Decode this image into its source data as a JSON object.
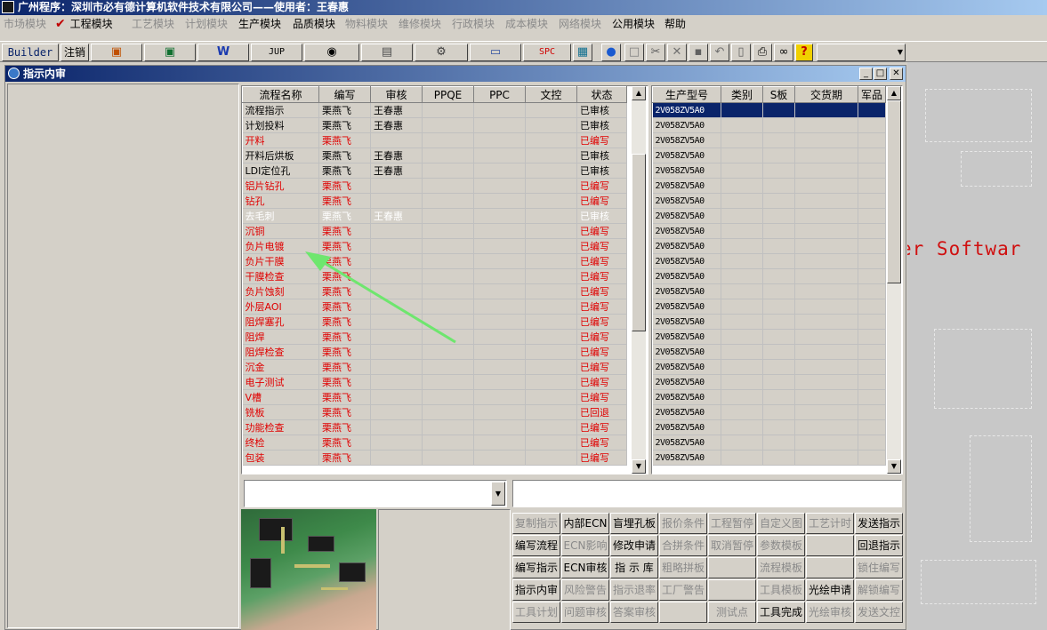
{
  "app": {
    "title": "广州程序：深圳市必有德计算机软件技术有限公司——使用者：王春惠"
  },
  "menu": [
    {
      "label": "市场模块",
      "enabled": false
    },
    {
      "label": "工程模块",
      "enabled": true,
      "checked": true
    },
    {
      "label": "工艺模块",
      "enabled": false
    },
    {
      "label": "计划模块",
      "enabled": false
    },
    {
      "label": "生产模块",
      "enabled": true
    },
    {
      "label": "品质模块",
      "enabled": true
    },
    {
      "label": "物料模块",
      "enabled": false
    },
    {
      "label": "维修模块",
      "enabled": false
    },
    {
      "label": "行政模块",
      "enabled": false
    },
    {
      "label": "成本模块",
      "enabled": false
    },
    {
      "label": "网络模块",
      "enabled": false
    },
    {
      "label": "公用模块",
      "enabled": true
    },
    {
      "label": "帮助",
      "enabled": true
    }
  ],
  "toolbar": {
    "builder": "Builder",
    "logout": "注销",
    "jup": "JUP",
    "spc": "SPC",
    "icons": [
      "ppt-icon",
      "excel-icon",
      "word-icon",
      "jup-icon",
      "eye-icon",
      "database-icon",
      "network-icon",
      "computer-icon",
      "spc-icon",
      "calculator-icon",
      "globe-icon",
      "new-doc-icon",
      "cut-icon",
      "delete-icon",
      "save-icon",
      "undo-icon",
      "preview-icon",
      "print-icon",
      "binoculars-icon",
      "help-icon"
    ]
  },
  "window": {
    "title": "指示内审"
  },
  "flow_table": {
    "headers": [
      "流程名称",
      "编写",
      "审核",
      "PPQE",
      "PPC",
      "文控",
      "状态"
    ],
    "rows": [
      {
        "name": "流程指示",
        "author": "栗燕飞",
        "reviewer": "王春惠",
        "status": "已审核",
        "red": false,
        "selected": false
      },
      {
        "name": "计划投料",
        "author": "栗燕飞",
        "reviewer": "王春惠",
        "status": "已审核",
        "red": false,
        "selected": false
      },
      {
        "name": "开料",
        "author": "栗燕飞",
        "reviewer": "",
        "status": "已编写",
        "red": true,
        "selected": false
      },
      {
        "name": "开料后烘板",
        "author": "栗燕飞",
        "reviewer": "王春惠",
        "status": "已审核",
        "red": false,
        "selected": false
      },
      {
        "name": "LDI定位孔",
        "author": "栗燕飞",
        "reviewer": "王春惠",
        "status": "已审核",
        "red": false,
        "selected": false
      },
      {
        "name": "铝片钻孔",
        "author": "栗燕飞",
        "reviewer": "",
        "status": "已编写",
        "red": true,
        "selected": false
      },
      {
        "name": "钻孔",
        "author": "栗燕飞",
        "reviewer": "",
        "status": "已编写",
        "red": true,
        "selected": false
      },
      {
        "name": "去毛刺",
        "author": "栗燕飞",
        "reviewer": "王春惠",
        "status": "已审核",
        "red": false,
        "selected": true
      },
      {
        "name": "沉铜",
        "author": "栗燕飞",
        "reviewer": "",
        "status": "已编写",
        "red": true,
        "selected": false
      },
      {
        "name": "负片电镀",
        "author": "栗燕飞",
        "reviewer": "",
        "status": "已编写",
        "red": true,
        "selected": false
      },
      {
        "name": "负片干膜",
        "author": "栗燕飞",
        "reviewer": "",
        "status": "已编写",
        "red": true,
        "selected": false
      },
      {
        "name": "干膜检查",
        "author": "栗燕飞",
        "reviewer": "",
        "status": "已编写",
        "red": true,
        "selected": false
      },
      {
        "name": "负片蚀刻",
        "author": "栗燕飞",
        "reviewer": "",
        "status": "已编写",
        "red": true,
        "selected": false
      },
      {
        "name": "外层AOI",
        "author": "栗燕飞",
        "reviewer": "",
        "status": "已编写",
        "red": true,
        "selected": false
      },
      {
        "name": "阻焊塞孔",
        "author": "栗燕飞",
        "reviewer": "",
        "status": "已编写",
        "red": true,
        "selected": false
      },
      {
        "name": "阻焊",
        "author": "栗燕飞",
        "reviewer": "",
        "status": "已编写",
        "red": true,
        "selected": false
      },
      {
        "name": "阻焊检查",
        "author": "栗燕飞",
        "reviewer": "",
        "status": "已编写",
        "red": true,
        "selected": false
      },
      {
        "name": "沉金",
        "author": "栗燕飞",
        "reviewer": "",
        "status": "已编写",
        "red": true,
        "selected": false
      },
      {
        "name": "电子测试",
        "author": "栗燕飞",
        "reviewer": "",
        "status": "已编写",
        "red": true,
        "selected": false
      },
      {
        "name": "V槽",
        "author": "栗燕飞",
        "reviewer": "",
        "status": "已编写",
        "red": true,
        "selected": false
      },
      {
        "name": "铣板",
        "author": "栗燕飞",
        "reviewer": "",
        "status": "已回退",
        "red": true,
        "selected": false
      },
      {
        "name": "功能检查",
        "author": "栗燕飞",
        "reviewer": "",
        "status": "已编写",
        "red": true,
        "selected": false
      },
      {
        "name": "终检",
        "author": "栗燕飞",
        "reviewer": "",
        "status": "已编写",
        "red": true,
        "selected": false
      },
      {
        "name": "包装",
        "author": "栗燕飞",
        "reviewer": "",
        "status": "已编写",
        "red": true,
        "selected": false
      }
    ]
  },
  "model_table": {
    "headers": [
      "生产型号",
      "类别",
      "S板",
      "交货期",
      "军品"
    ],
    "rows": [
      "2V058ZV5A0",
      "2V058ZV5A0",
      "2V058ZV5A0",
      "2V058ZV5A0",
      "2V058ZV5A0",
      "2V058ZV5A0",
      "2V058ZV5A0",
      "2V058ZV5A0",
      "2V058ZV5A0",
      "2V058ZV5A0",
      "2V058ZV5A0",
      "2V058ZV5A0",
      "2V058ZV5A0",
      "2V058ZV5A0",
      "2V058ZV5A0",
      "2V058ZV5A0",
      "2V058ZV5A0",
      "2V058ZV5A0",
      "2V058ZV5A0",
      "2V058ZV5A0",
      "2V058ZV5A0",
      "2V058ZV5A0",
      "2V058ZV5A0",
      "2V058ZV5A0"
    ]
  },
  "actions": [
    [
      {
        "l": "复制指示",
        "e": false
      },
      {
        "l": "内部ECN",
        "e": true
      },
      {
        "l": "盲埋孔板",
        "e": true
      },
      {
        "l": "报价条件",
        "e": false
      },
      {
        "l": "工程暂停",
        "e": false
      },
      {
        "l": "自定义图",
        "e": false
      },
      {
        "l": "工艺计时",
        "e": false
      },
      {
        "l": "发送指示",
        "e": true
      }
    ],
    [
      {
        "l": "编写流程",
        "e": true
      },
      {
        "l": "ECN影响",
        "e": false
      },
      {
        "l": "修改申请",
        "e": true
      },
      {
        "l": "合拼条件",
        "e": false
      },
      {
        "l": "取消暂停",
        "e": false
      },
      {
        "l": "参数模板",
        "e": false
      },
      {
        "l": "",
        "e": false
      },
      {
        "l": "回退指示",
        "e": true
      }
    ],
    [
      {
        "l": "编写指示",
        "e": true
      },
      {
        "l": "ECN审核",
        "e": true
      },
      {
        "l": "指 示 库",
        "e": true
      },
      {
        "l": "粗略拼板",
        "e": false
      },
      {
        "l": "",
        "e": false
      },
      {
        "l": "流程模板",
        "e": false
      },
      {
        "l": "",
        "e": false
      },
      {
        "l": "锁住编写",
        "e": false
      }
    ],
    [
      {
        "l": "指示内审",
        "e": true
      },
      {
        "l": "风险警告",
        "e": false
      },
      {
        "l": "指示退率",
        "e": false
      },
      {
        "l": "工厂警告",
        "e": false
      },
      {
        "l": "",
        "e": false
      },
      {
        "l": "工具模板",
        "e": false
      },
      {
        "l": "光绘申请",
        "e": true
      },
      {
        "l": "解锁编写",
        "e": false
      }
    ],
    [
      {
        "l": "工具计划",
        "e": false
      },
      {
        "l": "问题审核",
        "e": false
      },
      {
        "l": "答案审核",
        "e": false
      },
      {
        "l": "",
        "e": false
      },
      {
        "l": "测试点",
        "e": false
      },
      {
        "l": "工具完成",
        "e": true
      },
      {
        "l": "光绘审核",
        "e": false
      },
      {
        "l": "发送文控",
        "e": false
      }
    ]
  ],
  "background": {
    "text": "er Softwar"
  }
}
